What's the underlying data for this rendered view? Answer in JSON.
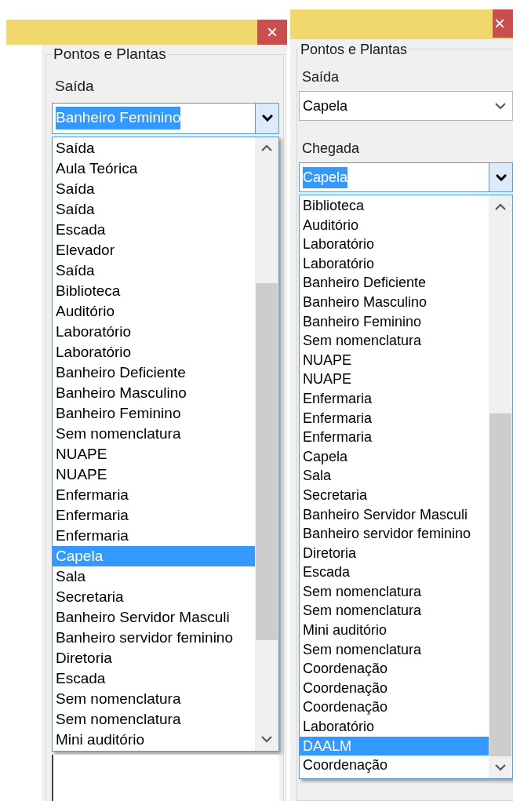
{
  "windows": [
    {
      "close": "×",
      "group_title": "Pontos e Plantas",
      "fields": [
        {
          "label": "Saída",
          "value": "Banheiro Feminino",
          "expanded": true,
          "options": [
            {
              "label": "Saída",
              "highlighted": false
            },
            {
              "label": "Aula Teórica",
              "highlighted": false
            },
            {
              "label": "Saída",
              "highlighted": false
            },
            {
              "label": "Saída",
              "highlighted": false
            },
            {
              "label": "Escada",
              "highlighted": false
            },
            {
              "label": "Elevador",
              "highlighted": false
            },
            {
              "label": "Saída",
              "highlighted": false
            },
            {
              "label": "Biblioteca",
              "highlighted": false
            },
            {
              "label": "Auditório",
              "highlighted": false
            },
            {
              "label": "Laboratório",
              "highlighted": false
            },
            {
              "label": "Laboratório",
              "highlighted": false
            },
            {
              "label": "Banheiro Deficiente",
              "highlighted": false
            },
            {
              "label": "Banheiro Masculino",
              "highlighted": false
            },
            {
              "label": "Banheiro Feminino",
              "highlighted": false
            },
            {
              "label": "Sem nomenclatura",
              "highlighted": false
            },
            {
              "label": "NUAPE",
              "highlighted": false
            },
            {
              "label": "NUAPE",
              "highlighted": false
            },
            {
              "label": "Enfermaria",
              "highlighted": false
            },
            {
              "label": "Enfermaria",
              "highlighted": false
            },
            {
              "label": "Enfermaria",
              "highlighted": false
            },
            {
              "label": "Capela",
              "highlighted": true
            },
            {
              "label": "Sala",
              "highlighted": false
            },
            {
              "label": "Secretaria",
              "highlighted": false
            },
            {
              "label": "Banheiro Servidor Masculi",
              "highlighted": false
            },
            {
              "label": "Banheiro servidor feminino",
              "highlighted": false
            },
            {
              "label": "Diretoria",
              "highlighted": false
            },
            {
              "label": "Escada",
              "highlighted": false
            },
            {
              "label": "Sem nomenclatura",
              "highlighted": false
            },
            {
              "label": "Sem nomenclatura",
              "highlighted": false
            },
            {
              "label": "Mini auditório",
              "highlighted": false
            }
          ]
        }
      ]
    },
    {
      "close": "×",
      "group_title": "Pontos e Plantas",
      "fields": [
        {
          "label": "Saída",
          "value": "Capela",
          "expanded": false
        },
        {
          "label": "Chegada",
          "value": "Capela",
          "expanded": true,
          "options": [
            {
              "label": "Biblioteca",
              "highlighted": false
            },
            {
              "label": "Auditório",
              "highlighted": false
            },
            {
              "label": "Laboratório",
              "highlighted": false
            },
            {
              "label": "Laboratório",
              "highlighted": false
            },
            {
              "label": "Banheiro Deficiente",
              "highlighted": false
            },
            {
              "label": "Banheiro Masculino",
              "highlighted": false
            },
            {
              "label": "Banheiro Feminino",
              "highlighted": false
            },
            {
              "label": "Sem nomenclatura",
              "highlighted": false
            },
            {
              "label": "NUAPE",
              "highlighted": false
            },
            {
              "label": "NUAPE",
              "highlighted": false
            },
            {
              "label": "Enfermaria",
              "highlighted": false
            },
            {
              "label": "Enfermaria",
              "highlighted": false
            },
            {
              "label": "Enfermaria",
              "highlighted": false
            },
            {
              "label": "Capela",
              "highlighted": false
            },
            {
              "label": "Sala",
              "highlighted": false
            },
            {
              "label": "Secretaria",
              "highlighted": false
            },
            {
              "label": "Banheiro Servidor Masculi",
              "highlighted": false
            },
            {
              "label": "Banheiro servidor feminino",
              "highlighted": false
            },
            {
              "label": "Diretoria",
              "highlighted": false
            },
            {
              "label": "Escada",
              "highlighted": false
            },
            {
              "label": "Sem nomenclatura",
              "highlighted": false
            },
            {
              "label": "Sem nomenclatura",
              "highlighted": false
            },
            {
              "label": "Mini auditório",
              "highlighted": false
            },
            {
              "label": "Sem nomenclatura",
              "highlighted": false
            },
            {
              "label": "Coordenação",
              "highlighted": false
            },
            {
              "label": "Coordenação",
              "highlighted": false
            },
            {
              "label": "Coordenação",
              "highlighted": false
            },
            {
              "label": "Laboratório",
              "highlighted": false
            },
            {
              "label": "DAALM",
              "highlighted": true
            },
            {
              "label": "Coordenação",
              "highlighted": false
            }
          ]
        }
      ]
    }
  ]
}
